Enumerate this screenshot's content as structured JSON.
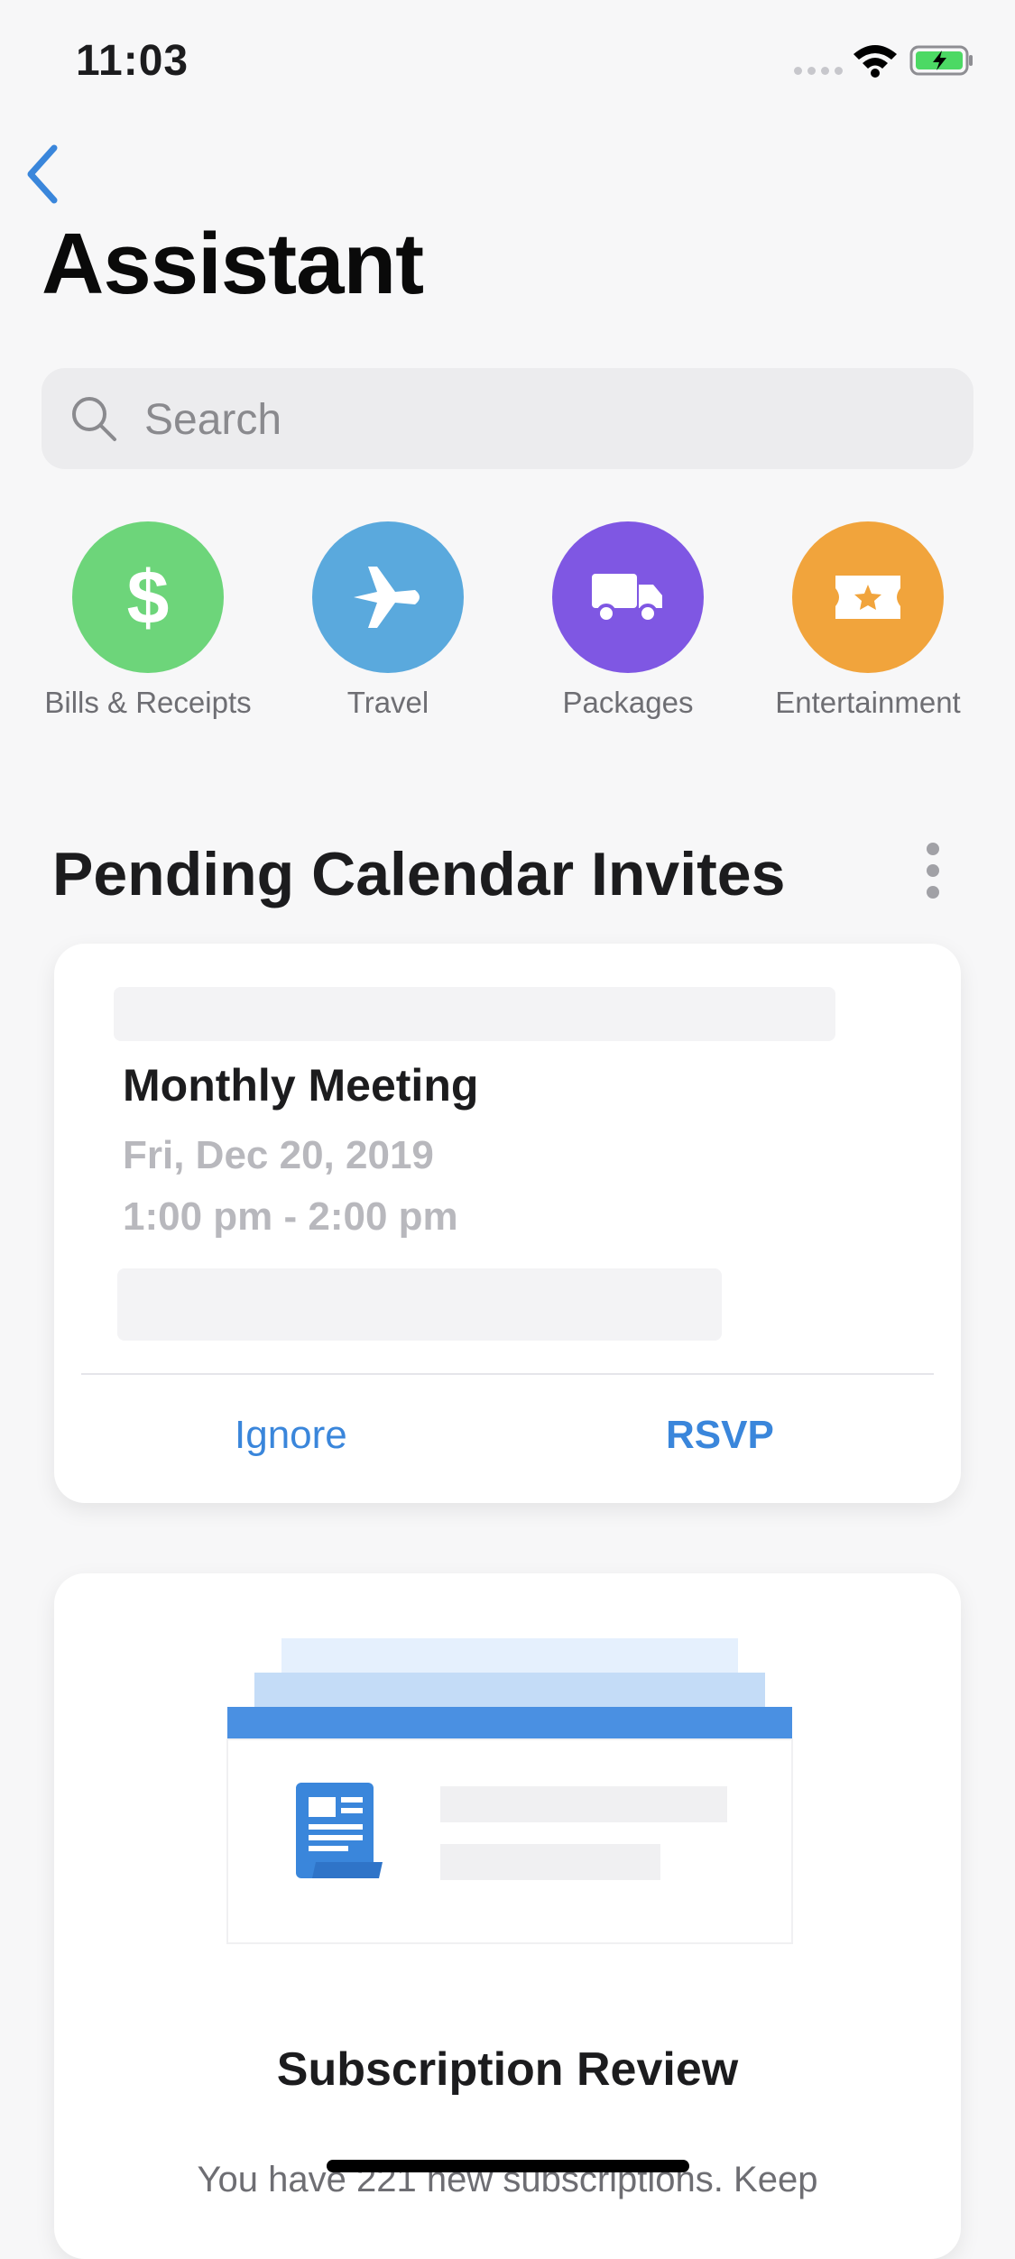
{
  "status_bar": {
    "time": "11:03"
  },
  "header": {
    "title": "Assistant",
    "back_icon": "chevron-left-icon"
  },
  "search": {
    "placeholder": "Search",
    "value": ""
  },
  "categories": [
    {
      "label": "Bills & Receipts",
      "icon": "dollar-icon",
      "color": "#6dd57a"
    },
    {
      "label": "Travel",
      "icon": "airplane-icon",
      "color": "#5aa9dd"
    },
    {
      "label": "Packages",
      "icon": "truck-icon",
      "color": "#7f57e3"
    },
    {
      "label": "Entertainment",
      "icon": "ticket-icon",
      "color": "#f1a43c"
    }
  ],
  "pending": {
    "title": "Pending Calendar Invites",
    "event_title": "Monthly Meeting",
    "date": "Fri, Dec 20, 2019",
    "time": "1:00 pm - 2:00 pm",
    "ignore_label": "Ignore",
    "rsvp_label": "RSVP"
  },
  "subscription": {
    "title": "Subscription Review",
    "text": "You have 221 new subscriptions. Keep"
  },
  "colors": {
    "accent": "#3a86db",
    "background": "#f7f7f8"
  }
}
